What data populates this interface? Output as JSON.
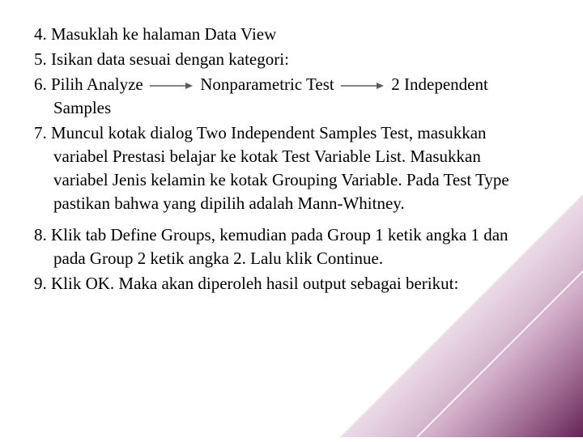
{
  "items": {
    "i4": "4. Masuklah ke halaman Data View",
    "i5": "5. Isikan data sesuai dengan kategori:",
    "i6a": "6. Pilih Analyze",
    "i6b": "Nonparametric Test",
    "i6c": "2 Independent Samples",
    "i7": "7. Muncul kotak dialog Two Independent Samples Test, masukkan variabel Prestasi belajar ke kotak Test Variable List. Masukkan variabel Jenis kelamin ke kotak Grouping Variable. Pada Test Type pastikan bahwa yang dipilih adalah Mann-Whitney.",
    "i8": "8. Klik tab Define Groups, kemudian pada Group 1 ketik angka 1 dan pada Group 2 ketik angka 2. Lalu klik Continue.",
    "i9": "9. Klik OK. Maka akan diperoleh hasil output sebagai berikut:"
  }
}
